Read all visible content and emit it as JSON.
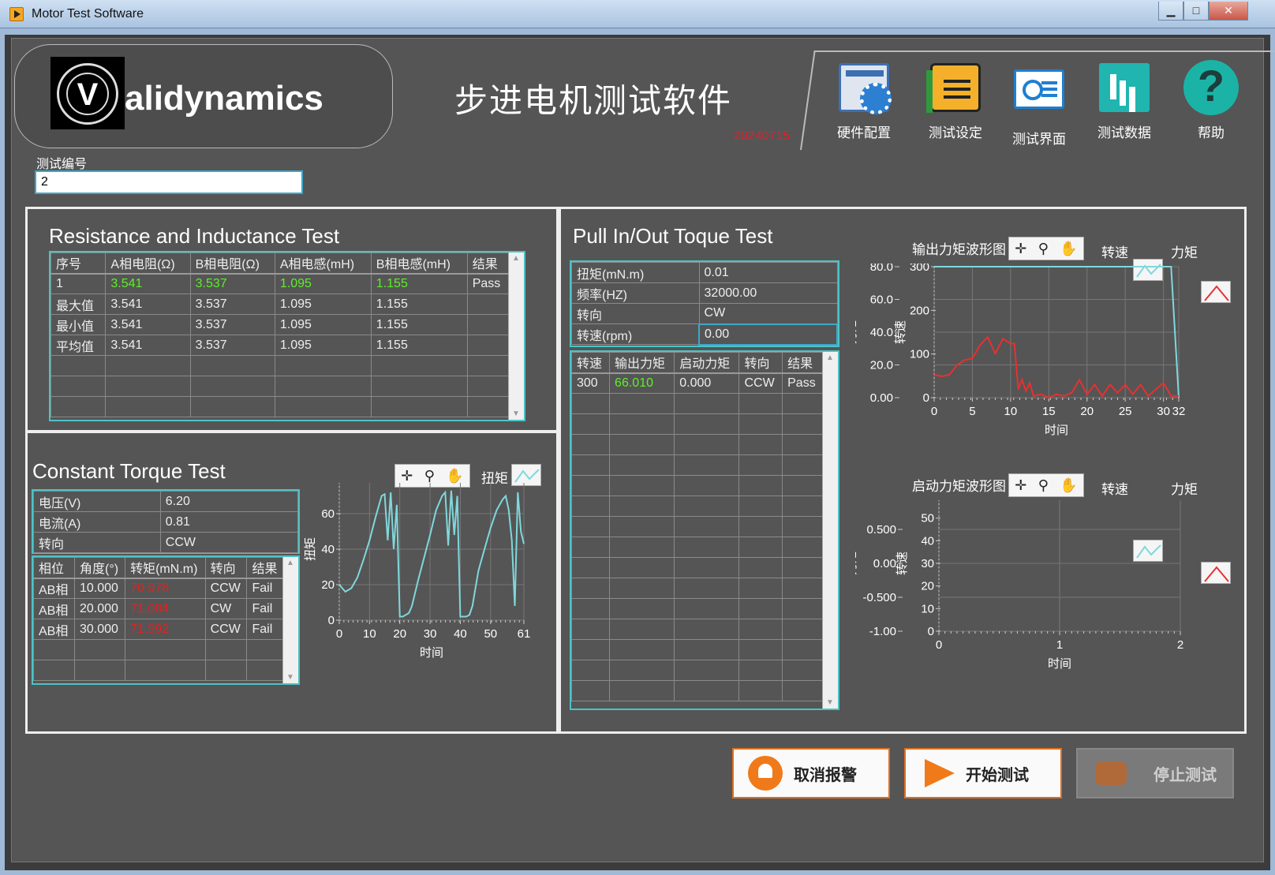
{
  "window": {
    "title": "Motor Test Software",
    "min": "▁",
    "max": "□",
    "close": "✕"
  },
  "header": {
    "brand": "alidynamics",
    "logo_letter": "V",
    "app_title": "步进电机测试软件",
    "version": "20240715",
    "tools": [
      {
        "label": "硬件配置",
        "icon": "hardware-config-icon"
      },
      {
        "label": "测试设定",
        "icon": "test-settings-icon"
      },
      {
        "label": "测试界面",
        "icon": "test-interface-icon"
      },
      {
        "label": "测试数据",
        "icon": "test-data-icon"
      },
      {
        "label": "帮助",
        "icon": "help-icon",
        "glyph": "?"
      }
    ]
  },
  "test_id": {
    "label": "测试编号",
    "value": "2"
  },
  "resistance": {
    "title": "Resistance and Inductance Test",
    "columns": [
      "序号",
      "A相电阻(Ω)",
      "B相电阻(Ω)",
      "A相电感(mH)",
      "B相电感(mH)",
      "结果"
    ],
    "rows": [
      [
        "1",
        "3.541",
        "3.537",
        "1.095",
        "1.155",
        "Pass"
      ],
      [
        "最大值",
        "3.541",
        "3.537",
        "1.095",
        "1.155",
        ""
      ],
      [
        "最小值",
        "3.541",
        "3.537",
        "1.095",
        "1.155",
        ""
      ],
      [
        "平均值",
        "3.541",
        "3.537",
        "1.095",
        "1.155",
        ""
      ]
    ]
  },
  "constant_torque": {
    "title": "Constant Torque Test",
    "params": [
      {
        "label": "电压(V)",
        "value": "6.20"
      },
      {
        "label": "电流(A)",
        "value": "0.81"
      },
      {
        "label": "转向",
        "value": "CCW"
      }
    ],
    "columns": [
      "相位",
      "角度(°)",
      "转矩(mN.m)",
      "转向",
      "结果"
    ],
    "rows": [
      [
        "AB相",
        "10.000",
        "70.978",
        "CCW",
        "Fail"
      ],
      [
        "AB相",
        "20.000",
        "71.084",
        "CW",
        "Fail"
      ],
      [
        "AB相",
        "30.000",
        "71.992",
        "CCW",
        "Fail"
      ]
    ],
    "legend": "扭矩",
    "palette": [
      "✛",
      "⚲",
      "✋"
    ]
  },
  "pull_test": {
    "title": "Pull In/Out Toque Test",
    "params": [
      {
        "label": "扭矩(mN.m)",
        "value": "0.01"
      },
      {
        "label": "频率(HZ)",
        "value": "32000.00"
      },
      {
        "label": "转向",
        "value": "CW"
      },
      {
        "label": "转速(rpm)",
        "value": "0.00"
      }
    ],
    "columns": [
      "转速",
      "输出力矩",
      "启动力矩",
      "转向",
      "结果"
    ],
    "rows": [
      [
        "300",
        "66.010",
        "0.000",
        "CCW",
        "Pass"
      ]
    ],
    "graph1_title": "输出力矩波形图",
    "graph2_title": "启动力矩波形图",
    "legend_speed": "转速",
    "legend_torque": "力矩",
    "palette": [
      "✛",
      "⚲",
      "✋"
    ]
  },
  "buttons": {
    "cancel": "取消报警",
    "start": "开始测试",
    "stop": "停止测试"
  },
  "colors": {
    "accent": "#4cc3c6",
    "pass_green": "#5cf028",
    "fail_red": "#e52020",
    "orange": "#f07a1a"
  },
  "chart_data": [
    {
      "type": "line",
      "name": "constant-torque",
      "xlabel": "时间",
      "ylabel": "扭矩",
      "xlim": [
        0,
        61
      ],
      "ylim": [
        0,
        80
      ],
      "xticks": [
        0,
        10,
        20,
        30,
        40,
        50,
        61
      ],
      "yticks": [
        0,
        20,
        40,
        60,
        80
      ],
      "series": [
        {
          "color": "#7fd8dc",
          "x": [
            0,
            2,
            4,
            6,
            8,
            10,
            12,
            14,
            15,
            16,
            17,
            18,
            19,
            20,
            21,
            22,
            23,
            24,
            25,
            26,
            28,
            30,
            32,
            34,
            35,
            36,
            37,
            38,
            39,
            40,
            41,
            42,
            43,
            44,
            45,
            46,
            48,
            50,
            52,
            54,
            55,
            56,
            57,
            58,
            59,
            60,
            61
          ],
          "y": [
            20,
            16,
            18,
            24,
            34,
            45,
            58,
            70,
            71,
            45,
            72,
            40,
            65,
            2,
            2,
            3,
            4,
            8,
            15,
            22,
            35,
            48,
            62,
            70,
            72,
            42,
            73,
            48,
            70,
            2,
            2,
            2,
            3,
            8,
            18,
            28,
            40,
            52,
            62,
            68,
            70,
            62,
            45,
            8,
            72,
            50,
            43
          ]
        }
      ]
    },
    {
      "type": "line",
      "name": "output-torque",
      "xlabel": "时间",
      "ylabel": "力矩",
      "y2label": "转速",
      "xlim": [
        0,
        32
      ],
      "ylim": [
        0,
        80
      ],
      "y2lim": [
        0,
        300
      ],
      "xticks": [
        0,
        5,
        10,
        15,
        20,
        25,
        30,
        32
      ],
      "yticks": [
        "0.00",
        "20.0",
        "40.0",
        "60.0",
        "80.0"
      ],
      "y2ticks": [
        0,
        100,
        200,
        300
      ],
      "series": [
        {
          "name": "转速",
          "color": "#7fd8dc",
          "axis": "y2",
          "x": [
            0,
            31,
            32
          ],
          "y": [
            300,
            300,
            0
          ]
        },
        {
          "name": "力矩",
          "color": "#e83030",
          "x": [
            0,
            1,
            2,
            3,
            4,
            5,
            6,
            7,
            8,
            9,
            10,
            10.5,
            11,
            11.5,
            12,
            12.5,
            13,
            14,
            15,
            16,
            17,
            18,
            19,
            20,
            21,
            22,
            23,
            24,
            25,
            26,
            27,
            28,
            29,
            30,
            31,
            32
          ],
          "y": [
            14,
            13,
            14,
            20,
            23,
            24,
            32,
            37,
            27,
            36,
            33,
            33,
            5,
            11,
            4,
            9,
            1,
            2,
            0,
            2,
            1,
            3,
            11,
            2,
            8,
            1,
            8,
            3,
            8,
            2,
            8,
            1,
            5,
            9,
            1,
            1
          ]
        }
      ]
    },
    {
      "type": "line",
      "name": "starting-torque",
      "xlabel": "时间",
      "ylabel": "力矩",
      "y2label": "转速",
      "xlim": [
        0,
        2
      ],
      "ylim": [
        -1,
        1
      ],
      "y2lim": [
        0,
        60
      ],
      "xticks": [
        0,
        1,
        2
      ],
      "yticks": [
        "-1.00",
        "-0.500",
        "0.00",
        "0.500",
        "1.00"
      ],
      "y2ticks": [
        0,
        10,
        20,
        30,
        40,
        50,
        60
      ],
      "series": []
    }
  ]
}
